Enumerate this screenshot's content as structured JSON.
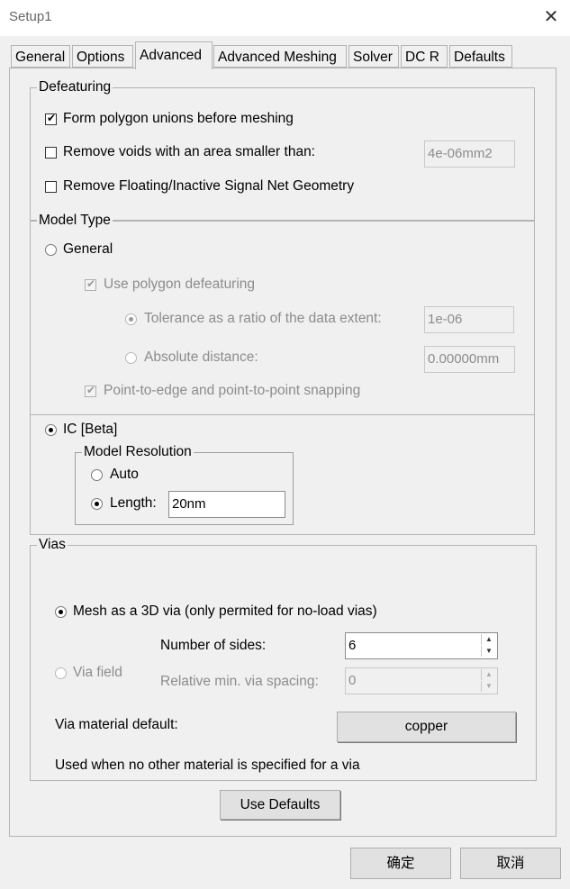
{
  "window": {
    "title": "Setup1",
    "close_glyph": "✕"
  },
  "tabs": [
    {
      "label": "General"
    },
    {
      "label": "Options"
    },
    {
      "label": "Advanced"
    },
    {
      "label": "Advanced Meshing"
    },
    {
      "label": "Solver"
    },
    {
      "label": "DC R"
    },
    {
      "label": "Defaults"
    }
  ],
  "active_tab": "Advanced",
  "defeaturing": {
    "legend": "Defeaturing",
    "polygon_unions": {
      "label": "Form polygon unions before meshing",
      "checked": true
    },
    "remove_voids": {
      "label": "Remove voids with an area smaller than:",
      "checked": false,
      "value": "4e-06mm2"
    },
    "remove_floating": {
      "label": "Remove Floating/Inactive Signal Net Geometry",
      "checked": false
    }
  },
  "model_type": {
    "legend": "Model Type",
    "general": {
      "label": "General",
      "selected": false
    },
    "use_polygon_defeaturing": {
      "label": "Use polygon defeaturing",
      "checked": true
    },
    "tolerance_ratio": {
      "label": "Tolerance as a ratio of the data extent:",
      "selected": true,
      "value": "1e-06"
    },
    "absolute_distance": {
      "label": "Absolute distance:",
      "selected": false,
      "value": "0.00000mm"
    },
    "snapping": {
      "label": "Point-to-edge and point-to-point snapping",
      "checked": true
    },
    "ic_beta": {
      "label": "IC [Beta]",
      "selected": true
    },
    "model_resolution": {
      "legend": "Model Resolution",
      "auto": {
        "label": "Auto",
        "selected": false
      },
      "length": {
        "label": "Length:",
        "selected": true,
        "value": "20nm"
      }
    }
  },
  "vias": {
    "legend": "Vias",
    "mesh_3d": {
      "label": "Mesh as a 3D via (only permited for no-load vias)",
      "selected": true
    },
    "via_field": {
      "label": "Via field",
      "selected": false
    },
    "number_of_sides": {
      "label": "Number of sides:",
      "value": "6"
    },
    "relative_spacing": {
      "label": "Relative min. via spacing:",
      "value": "0"
    },
    "material_default": {
      "label": "Via material default:",
      "button": "copper"
    },
    "note": "Used when no other material is specified for a via"
  },
  "use_defaults_button": "Use Defaults",
  "footer": {
    "ok": "确定",
    "cancel": "取消"
  },
  "glyphs": {
    "check": "✔",
    "spin_up": "▲",
    "spin_down": "▼"
  }
}
